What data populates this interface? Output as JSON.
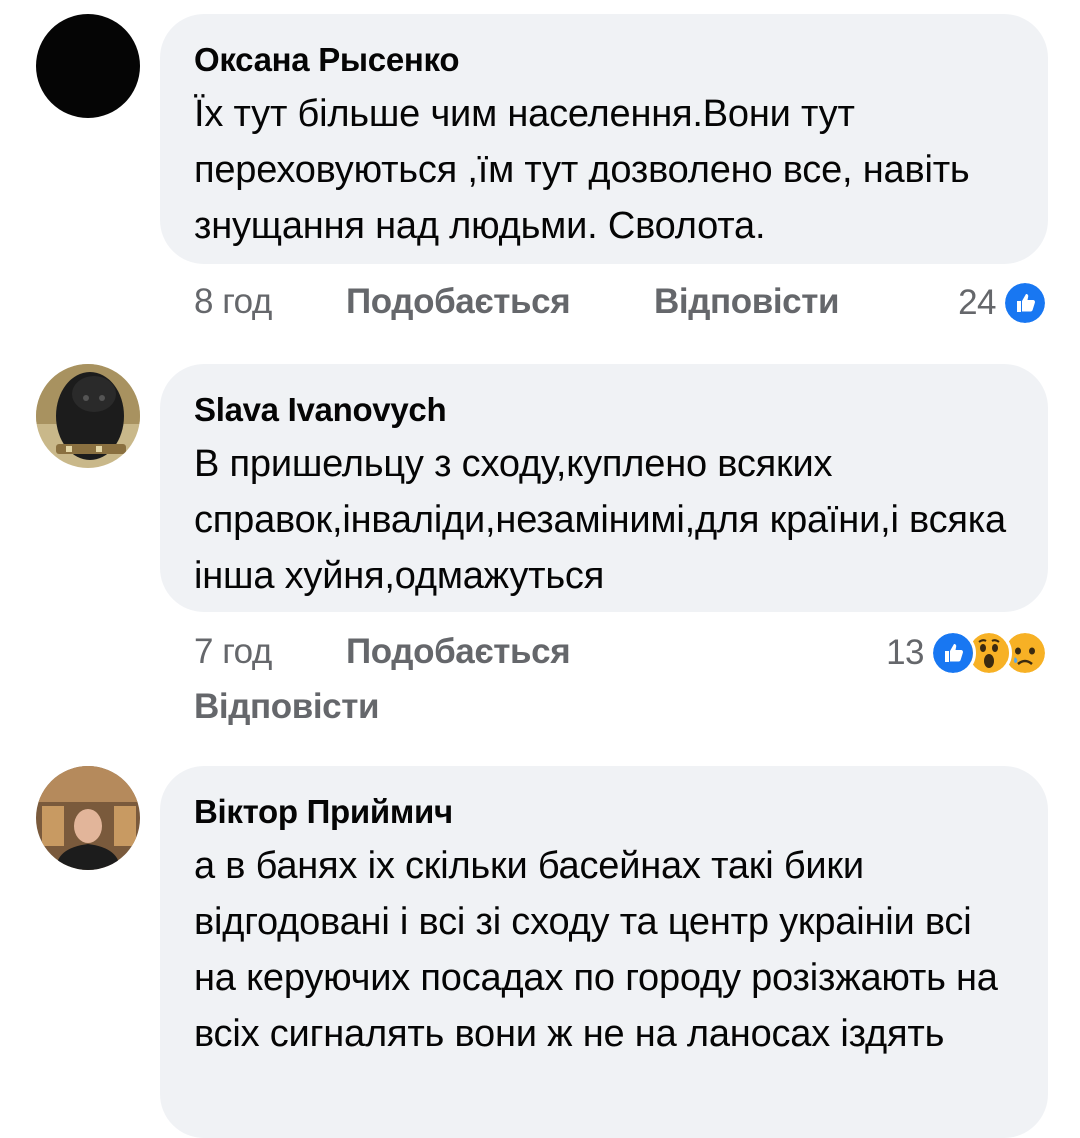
{
  "comments": [
    {
      "author": "Оксана Рысенко",
      "text": "Їх тут більше чим населення.Вони тут переховуються ,їм тут дозволено все, навіть знущання над людьми. Сволота.",
      "time": "8 год",
      "like_label": "Подобається",
      "reply_label": "Відповісти",
      "reaction_count": "24",
      "reactions": [
        "like-icon"
      ]
    },
    {
      "author": "Slava Ivanovych",
      "text": "В пришельцу з сходу,куплено  всяких справок,інваліди,незамінимі,для країни,і всяка інша хуйня,одмажуться",
      "time": "7 год",
      "like_label": "Подобається",
      "reply_label": "Відповісти",
      "reaction_count": "13",
      "reactions": [
        "like-icon",
        "wow-icon",
        "sad-icon"
      ]
    },
    {
      "author": "Віктор Приймич",
      "text": "а в банях іх скільки басейнах такі бики відгодовані і всі зі сходу та центр украініи всі  на керуючих посадах по городу розізжають на всіх сигналять вони ж не на ланосах іздять"
    }
  ],
  "colors": {
    "bubble": "#f0f2f5",
    "meta_text": "#65676b",
    "like_blue": "#1877f2",
    "emoji_yellow": "#f7b125"
  }
}
